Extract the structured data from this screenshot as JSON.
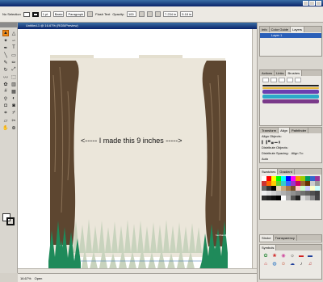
{
  "control_bar": {
    "selection_label": "No Selection",
    "zoom_field": "1 pt",
    "brush_field": "Basic",
    "style_field": "Paragraph",
    "opacity_label": "Opacity:",
    "opacity_value": "100",
    "flash_text": "Flash Text",
    "coord_x": "7.234 in",
    "coord_y": "5.18 in"
  },
  "document": {
    "tab_title": "Untitled-1 @ 16.67% (RGB/Preview)",
    "annotation": "<----- I made this 9 inches ----->",
    "watermark": "fourthandjoyblog.blogspot.com"
  },
  "status_bar": {
    "zoom": "16.67%",
    "status": "Open"
  },
  "panels": {
    "layers": {
      "tabs": [
        "Info",
        "Color Guide",
        "Layers"
      ],
      "layer_name": "Layer 1"
    },
    "brushes": {
      "tabs": [
        "Actions",
        "Links",
        "Brushes"
      ]
    },
    "align": {
      "tabs": [
        "Transform",
        "Align",
        "Pathfinder"
      ],
      "align_objects": "Align Objects:",
      "distribute_objects": "Distribute Objects:",
      "distribute_spacing": "Distribute Spacing:",
      "align_to": "Align To:",
      "spacing_value": "Auto"
    },
    "swatches": {
      "tabs": [
        "Swatches",
        "Gradient"
      ]
    },
    "stroke": {
      "tabs": [
        "Stroke",
        "Transparency"
      ]
    },
    "symbols": {
      "tabs": [
        "Symbols"
      ]
    }
  },
  "colors": {
    "accent_tool": "#f08c1c",
    "bark": "#5d4630",
    "grass_dark": "#1f8a5a",
    "grass_light": "#c8d3bd",
    "canvas": "#ebe6da"
  }
}
